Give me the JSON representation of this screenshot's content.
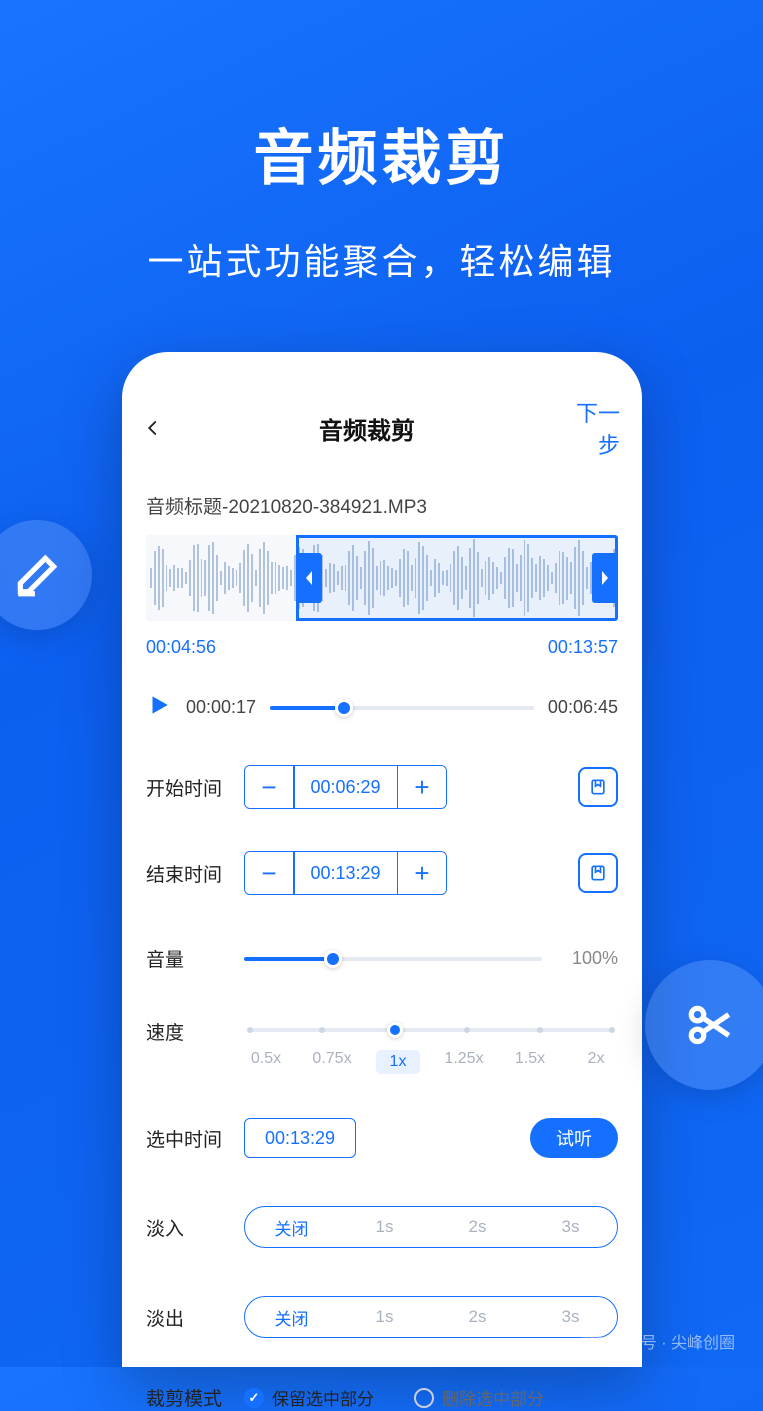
{
  "hero": {
    "title": "音频裁剪",
    "subtitle": "一站式功能聚合，轻松编辑"
  },
  "nav": {
    "title": "音频裁剪",
    "next": "下一步"
  },
  "file": {
    "name": "音频标题-20210820-384921.MP3"
  },
  "waveform": {
    "start": "00:04:56",
    "end": "00:13:57"
  },
  "player": {
    "current": "00:00:17",
    "total": "00:06:45",
    "progress_pct": 28
  },
  "start_time": {
    "label": "开始时间",
    "value": "00:06:29"
  },
  "end_time": {
    "label": "结束时间",
    "value": "00:13:29"
  },
  "volume": {
    "label": "音量",
    "value": "100%",
    "pct": 30
  },
  "speed": {
    "label": "速度",
    "options": [
      "0.5x",
      "0.75x",
      "1x",
      "1.25x",
      "1.5x",
      "2x"
    ],
    "selected": "1x"
  },
  "selected": {
    "label": "选中时间",
    "value": "00:13:29",
    "listen": "试听"
  },
  "fade_in": {
    "label": "淡入",
    "options": [
      "关闭",
      "1s",
      "2s",
      "3s"
    ],
    "selected": "关闭"
  },
  "fade_out": {
    "label": "淡出",
    "options": [
      "关闭",
      "1s",
      "2s",
      "3s"
    ],
    "selected": "关闭"
  },
  "crop_mode": {
    "label": "裁剪模式",
    "opt1": "保留选中部分",
    "opt2": "删除选中部分",
    "selected": 0
  },
  "watermark": {
    "text": "公众号 · 尖峰创圈"
  }
}
